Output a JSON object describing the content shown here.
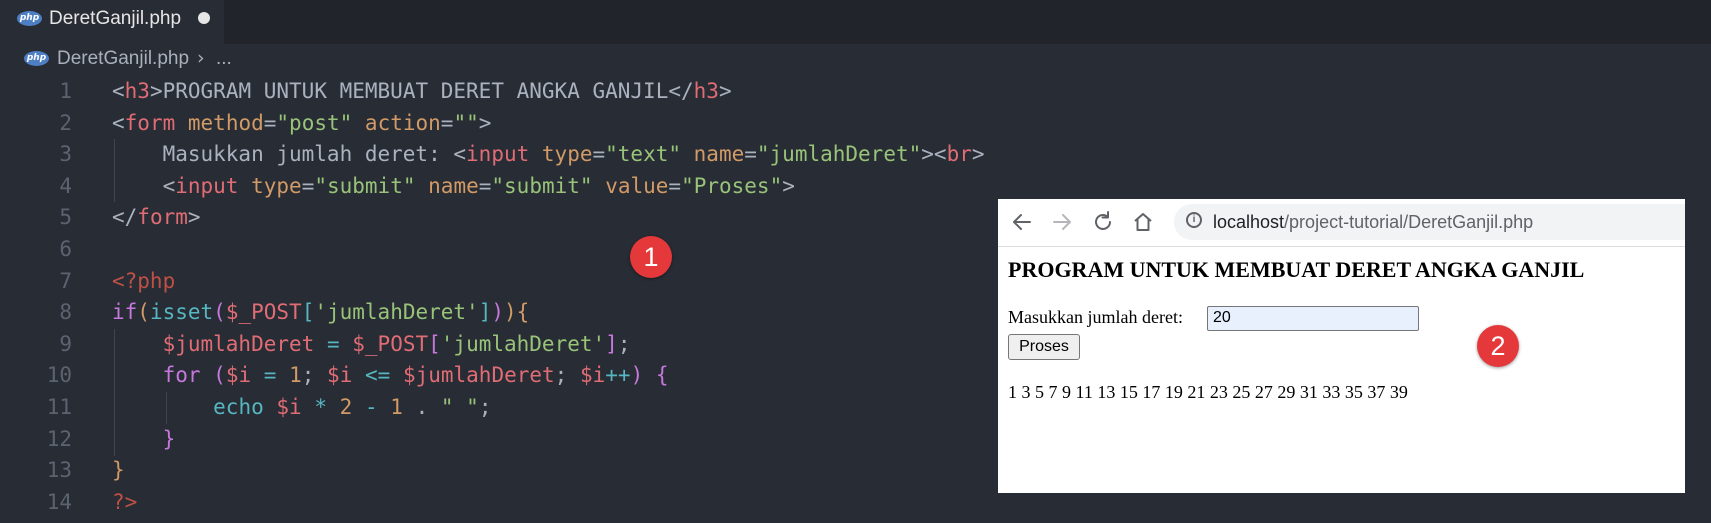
{
  "tab": {
    "icon": "php",
    "title": "DeretGanjil.php"
  },
  "breadcrumb": {
    "icon": "php",
    "file": "DeretGanjil.php",
    "separator": "›",
    "rest": "..."
  },
  "editor": {
    "line_numbers": [
      "1",
      "2",
      "3",
      "4",
      "5",
      "6",
      "7",
      "8",
      "9",
      "10",
      "11",
      "12",
      "13",
      "14"
    ]
  },
  "badges": {
    "left": "1",
    "right": "2"
  },
  "browser": {
    "url_host": "localhost",
    "url_path": "/project-tutorial/DeretGanjil.php",
    "page_heading": "PROGRAM UNTUK MEMBUAT DERET ANGKA GANJIL",
    "input_label": "Masukkan jumlah deret:",
    "input_value": "20",
    "button_label": "Proses",
    "output": "1 3 5 7 9 11 13 15 17 19 21 23 25 27 29 31 33 35 37 39"
  },
  "colors": {
    "editor_bg": "#282c34",
    "tag": "#e06c75",
    "string": "#98c379",
    "attribute": "#d19a66",
    "keyword": "#c678dd",
    "function": "#56b6c2",
    "badge": "#e5383b"
  }
}
